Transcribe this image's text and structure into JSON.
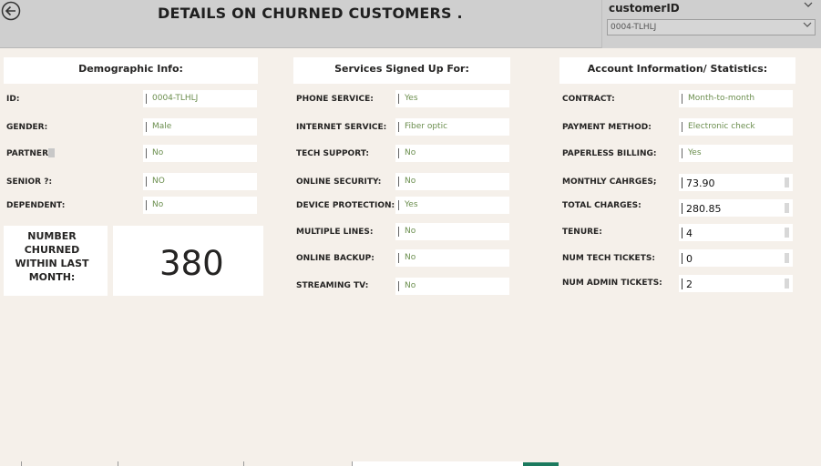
{
  "header": {
    "title": "DETAILS ON CHURNED CUSTOMERS .",
    "back_icon": "back-arrow-icon"
  },
  "slicer": {
    "title": "customerID",
    "value": "0004-TLHLJ",
    "chevron": "chevron-down-icon"
  },
  "demographic": {
    "header": "Demographic Info:",
    "rows": [
      {
        "label": "ID:",
        "value": "0004-TLHLJ"
      },
      {
        "label": "GENDER:",
        "value": "Male"
      },
      {
        "label": "PARTNER",
        "value": "No"
      },
      {
        "label": "SENIOR ?:",
        "value": "NO"
      },
      {
        "label": "DEPENDENT:",
        "value": "No"
      }
    ]
  },
  "churn_card": {
    "label": "NUMBER CHURNED WITHIN LAST MONTH:",
    "value": "380"
  },
  "services": {
    "header": "Services Signed Up For:",
    "rows": [
      {
        "label": "PHONE SERVICE:",
        "value": "Yes"
      },
      {
        "label": "INTERNET SERVICE:",
        "value": "Fiber optic"
      },
      {
        "label": "TECH SUPPORT:",
        "value": "No"
      },
      {
        "label": "ONLINE SECURITY:",
        "value": "No"
      },
      {
        "label": "DEVICE PROTECTION:",
        "value": "Yes"
      },
      {
        "label": "MULTIPLE LINES:",
        "value": "No"
      },
      {
        "label": "ONLINE BACKUP:",
        "value": "No"
      },
      {
        "label": "STREAMING TV:",
        "value": "No"
      }
    ]
  },
  "account": {
    "header": "Account Information/ Statistics:",
    "text_rows": [
      {
        "label": "CONTRACT:",
        "value": "Month-to-month"
      },
      {
        "label": "PAYMENT METHOD:",
        "value": "Electronic check"
      },
      {
        "label": "PAPERLESS BILLING:",
        "value": "Yes"
      }
    ],
    "num_rows": [
      {
        "label": "MONTHLY CAHRGES;",
        "value": "73.90"
      },
      {
        "label": "TOTAL CHARGES:",
        "value": "280.85"
      },
      {
        "label": "TENURE:",
        "value": "4"
      },
      {
        "label": "NUM TECH TICKETS:",
        "value": "0"
      },
      {
        "label": "NUM ADMIN TICKETS:",
        "value": "2"
      }
    ]
  },
  "colors": {
    "value_text": "#6b8e4e",
    "header_bg": "#cfcfcf",
    "page_bg": "#f5f0ea",
    "active_tab": "#1b7a5e"
  }
}
